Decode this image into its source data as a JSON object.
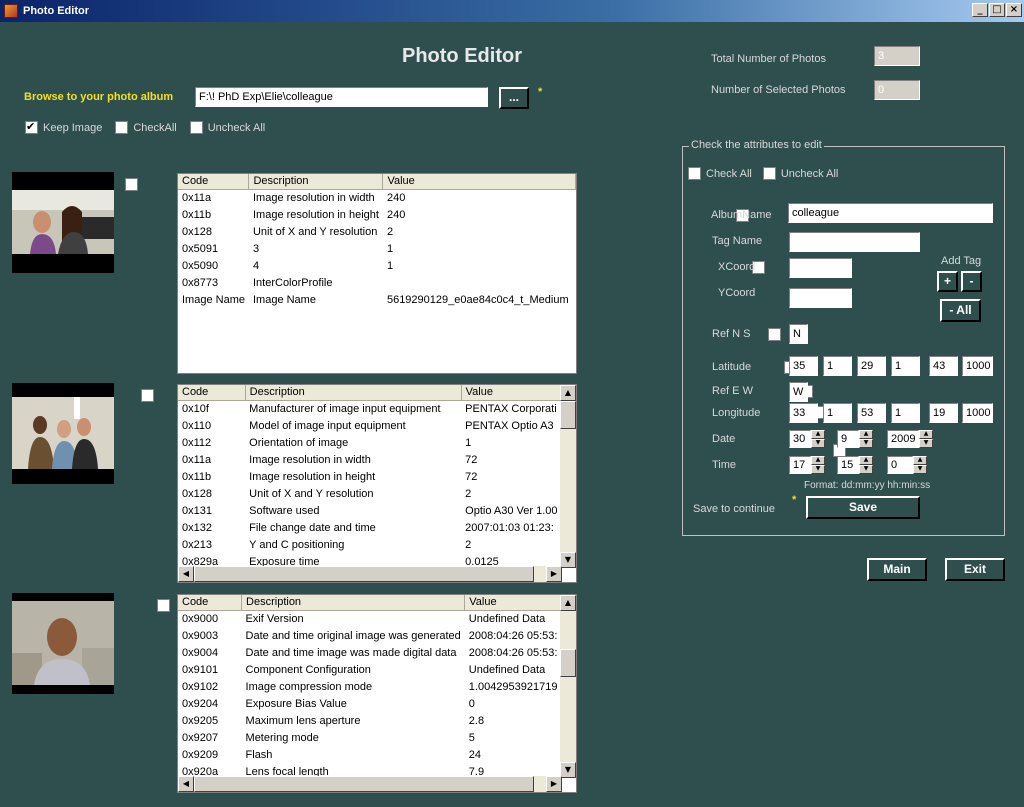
{
  "window": {
    "title": "Photo Editor",
    "min": "_",
    "max": "□",
    "close": "×"
  },
  "heading": "Photo Editor",
  "browse": {
    "label": "Browse to your photo album",
    "path": "F:\\! PhD Exp\\Elie\\colleague",
    "button": "...",
    "required": "*"
  },
  "options": {
    "keep_image": "Keep Image",
    "check_all": "CheckAll",
    "uncheck_all": "Uncheck All"
  },
  "stats": {
    "total_label": "Total Number of Photos",
    "total_value": "3",
    "selected_label": "Number of Selected Photos",
    "selected_value": "0"
  },
  "grids": [
    {
      "columns": [
        "Code",
        "Description",
        "Value"
      ],
      "rows": [
        [
          "0x11a",
          "Image resolution in width",
          "240"
        ],
        [
          "0x11b",
          "Image resolution in height",
          "240"
        ],
        [
          "0x128",
          "Unit of X and Y resolution",
          "2"
        ],
        [
          "0x5091",
          "3",
          "1"
        ],
        [
          "0x5090",
          "4",
          "1"
        ],
        [
          "0x8773",
          "InterColorProfile",
          ""
        ],
        [
          "Image Name",
          "Image Name",
          "5619290129_e0ae84c0c4_t_Medium"
        ]
      ]
    },
    {
      "columns": [
        "Code",
        "Description",
        "Value"
      ],
      "rows": [
        [
          "0x10f",
          "Manufacturer of image input equipment",
          "PENTAX Corporati"
        ],
        [
          "0x110",
          "Model of image input equipment",
          "PENTAX Optio A3"
        ],
        [
          "0x112",
          "Orientation of image",
          "1"
        ],
        [
          "0x11a",
          "Image resolution in width",
          "72"
        ],
        [
          "0x11b",
          "Image resolution in height",
          "72"
        ],
        [
          "0x128",
          "Unit of X and Y resolution",
          "2"
        ],
        [
          "0x131",
          "Software used",
          "Optio A30 Ver 1.00"
        ],
        [
          "0x132",
          "File change date and time",
          "2007:01:03 01:23:"
        ],
        [
          "0x213",
          "Y and C positioning",
          "2"
        ],
        [
          "0x829a",
          "Exposure time",
          "0.0125"
        ]
      ]
    },
    {
      "columns": [
        "Code",
        "Description",
        "Value"
      ],
      "rows": [
        [
          "0x9000",
          "Exif Version",
          "Undefined Data"
        ],
        [
          "0x9003",
          "Date and time original image was generated",
          "2008:04:26 05:53:"
        ],
        [
          "0x9004",
          "Date and time image was made digital data",
          "2008:04:26 05:53:"
        ],
        [
          "0x9101",
          "Component Configuration",
          "Undefined Data"
        ],
        [
          "0x9102",
          "Image compression mode",
          "1.0042953921719"
        ],
        [
          "0x9204",
          "Exposure Bias Value",
          "0"
        ],
        [
          "0x9205",
          "Maximum lens aperture",
          "2.8"
        ],
        [
          "0x9207",
          "Metering mode",
          "5"
        ],
        [
          "0x9209",
          "Flash",
          "24"
        ],
        [
          "0x920a",
          "Lens focal length",
          "7.9"
        ]
      ]
    }
  ],
  "attributes": {
    "group_label": "Check the attributes to edit",
    "check_all": "Check All",
    "uncheck_all": "Uncheck All",
    "album_name_label": "AlbumName",
    "album_name_value": "colleague",
    "tag_name_label": "Tag Name",
    "tag_name_value": "",
    "xcoord_label": "XCoord",
    "ycoord_label": "YCoord",
    "add_tag_label": "Add Tag",
    "plus": "+",
    "minus": "-",
    "minus_all": "- All",
    "ref_ns_label": "Ref N S",
    "ref_ns_value": "N",
    "latitude_label": "Latitude",
    "latitude": [
      "35",
      "1",
      "29",
      "1",
      "43",
      "1000"
    ],
    "ref_ew_label": "Ref E W",
    "ref_ew_value": "W",
    "longitude_label": "Longitude",
    "longitude": [
      "33",
      "1",
      "53",
      "1",
      "19",
      "1000"
    ],
    "date_label": "Date",
    "date": [
      "30",
      "9",
      "2009"
    ],
    "time_label": "Time",
    "time": [
      "17",
      "15",
      "0"
    ],
    "format_hint": "Format: dd:mm:yy hh:min:ss",
    "save_label": "Save to continue",
    "save_required": "*",
    "save_button": "Save"
  },
  "footer": {
    "main": "Main",
    "exit": "Exit"
  }
}
